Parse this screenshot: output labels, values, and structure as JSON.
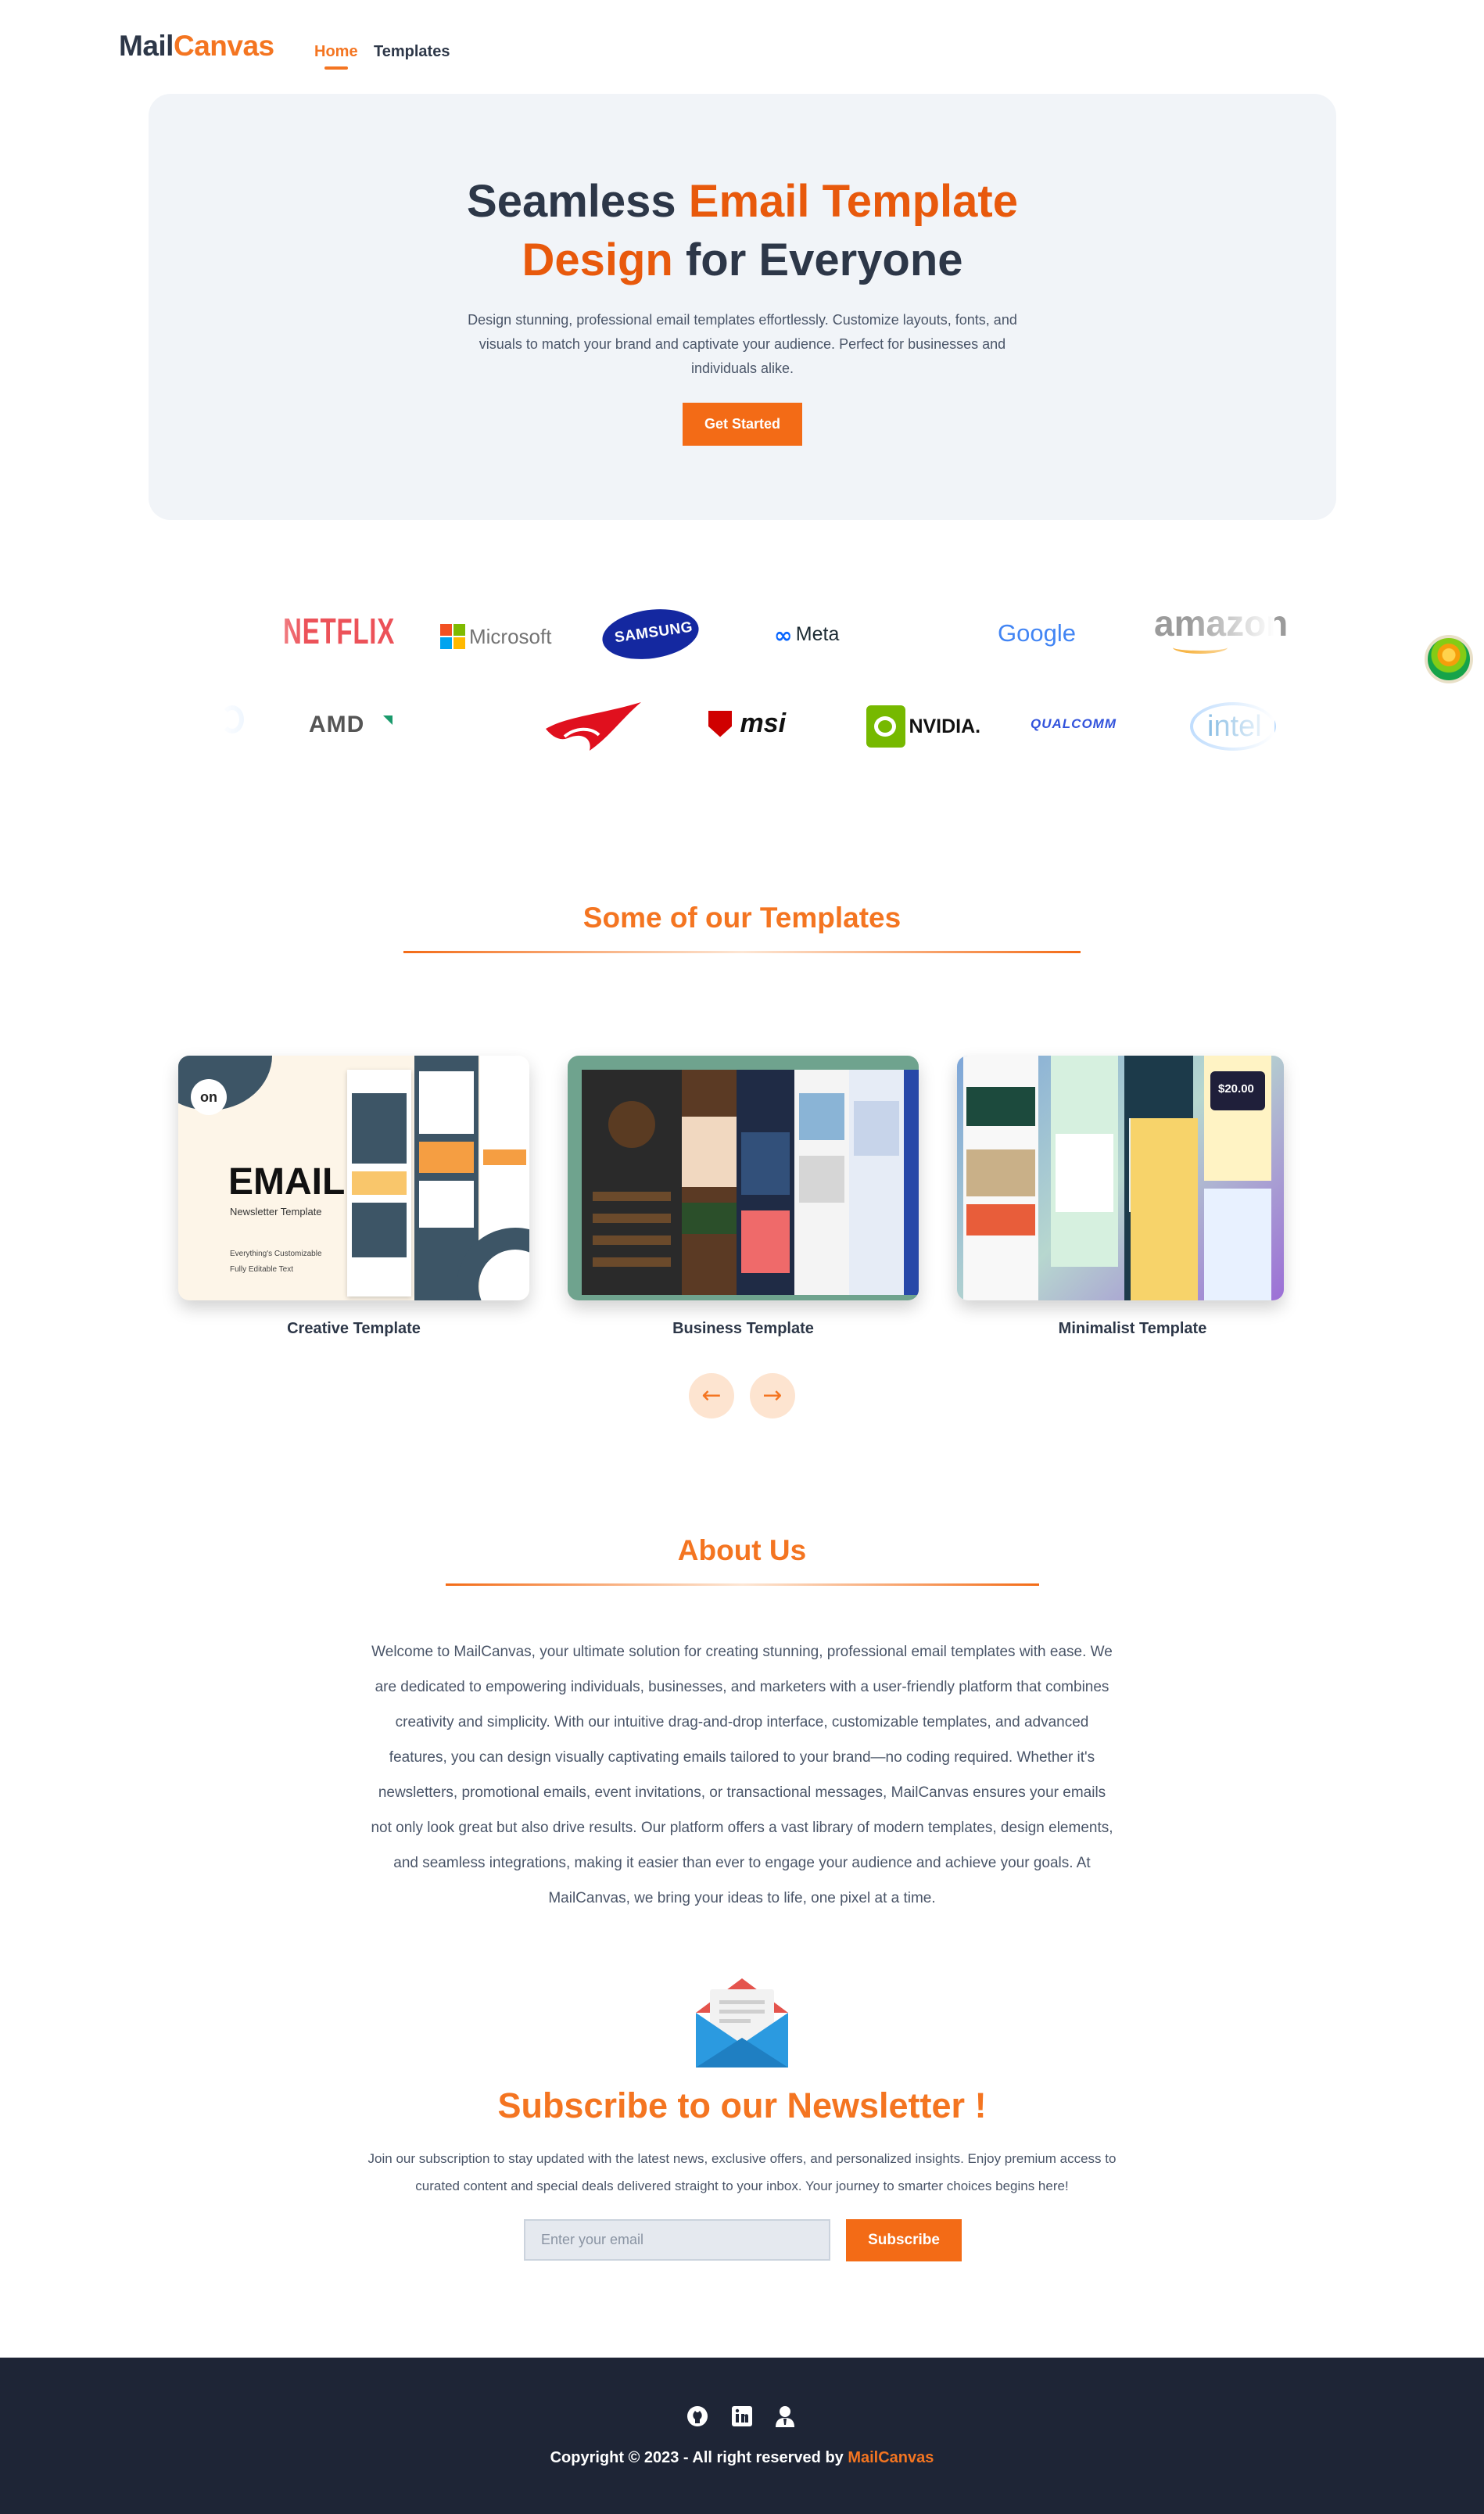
{
  "nav": {
    "logo_part1": "Mail",
    "logo_part2": "Canvas",
    "links": [
      {
        "label": "Home",
        "active": true
      },
      {
        "label": "Templates",
        "active": false
      }
    ]
  },
  "hero": {
    "title_1": "Seamless ",
    "title_2": "Email Template",
    "title_3": "Design",
    "title_4": " for Everyone",
    "description": "Design stunning, professional email templates effortlessly. Customize layouts, fonts, and visuals to match your brand and captivate your audience. Perfect for businesses and individuals alike.",
    "cta_label": "Get Started"
  },
  "brands": {
    "row1": [
      "NETFLIX",
      "Microsoft",
      "SAMSUNG",
      "Meta",
      "Google",
      "amazon"
    ],
    "row2": [
      "AMD",
      "msi",
      "NVIDIA.",
      "QUALCOMM",
      "intel"
    ]
  },
  "templates_section": {
    "title": "Some of our Templates",
    "cards": [
      {
        "label": "Creative Template",
        "preview_title": "EMAIL",
        "preview_subtitle": "Newsletter Template",
        "preview_bullets": [
          "Everything's Customizable",
          "Fully Editable Text"
        ]
      },
      {
        "label": "Business Template"
      },
      {
        "label": "Minimalist Template",
        "preview_price": "$20.00"
      }
    ],
    "prev_icon": "arrow-left-icon",
    "next_icon": "arrow-right-icon"
  },
  "about": {
    "title": "About Us",
    "text": "Welcome to MailCanvas, your ultimate solution for creating stunning, professional email templates with ease. We are dedicated to empowering individuals, businesses, and marketers with a user-friendly platform that combines creativity and simplicity. With our intuitive drag-and-drop interface, customizable templates, and advanced features, you can design visually captivating emails tailored to your brand—no coding required. Whether it's newsletters, promotional emails, event invitations, or transactional messages, MailCanvas ensures your emails not only look great but also drive results. Our platform offers a vast library of modern templates, design elements, and seamless integrations, making it easier than ever to engage your audience and achieve your goals. At MailCanvas, we bring your ideas to life, one pixel at a time."
  },
  "newsletter": {
    "icon": "envelope-icon",
    "title": "Subscribe to our Newsletter !",
    "description": "Join our subscription to stay updated with the latest news, exclusive offers, and personalized insights. Enjoy premium access to curated content and special deals delivered straight to your inbox. Your journey to smarter choices begins here!",
    "email_placeholder": "Enter your email",
    "subscribe_label": "Subscribe"
  },
  "footer": {
    "icons": [
      "github-icon",
      "linkedin-icon",
      "portfolio-icon"
    ],
    "copyright": "Copyright © 2023 - All right reserved by ",
    "brand": "MailCanvas"
  },
  "colors": {
    "accent": "#f47521",
    "dark": "#2d3748",
    "hero_bg": "#f1f4f8",
    "footer_bg": "#1e2536"
  }
}
